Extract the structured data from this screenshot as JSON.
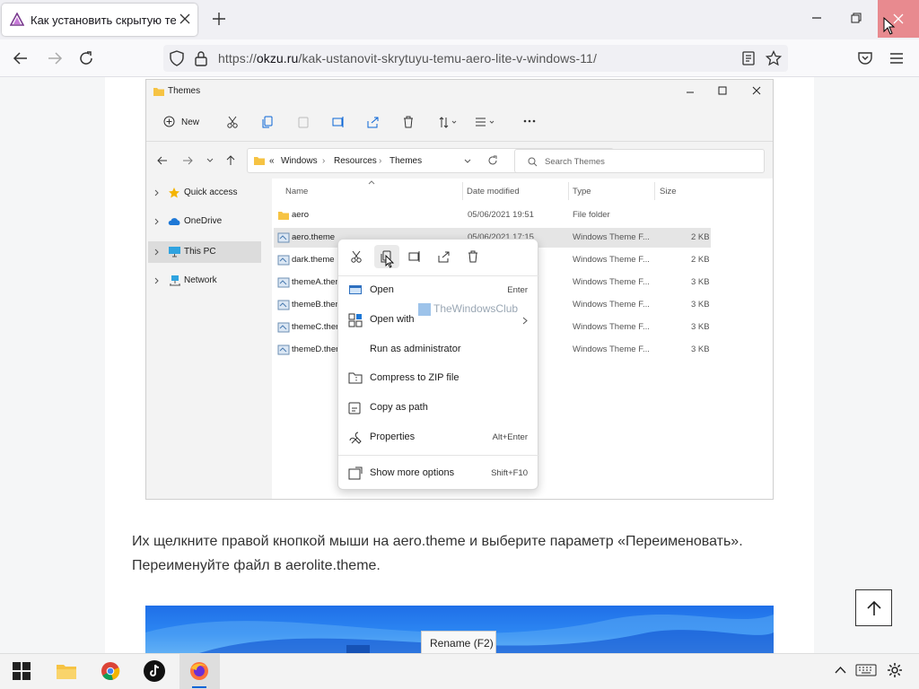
{
  "browser": {
    "tab_title": "Как установить скрытую тему",
    "url_domain": "okzu.ru",
    "url_path": "/kak-ustanovit-skrytuyu-temu-aero-lite-v-windows-11/"
  },
  "explorer": {
    "title": "Themes",
    "new_label": "New",
    "breadcrumb": [
      "Windows",
      "Resources",
      "Themes"
    ],
    "breadcrumb_prefix": "«",
    "search_placeholder": "Search Themes",
    "nav": [
      "Quick access",
      "OneDrive",
      "This PC",
      "Network"
    ],
    "columns": [
      "Name",
      "Date modified",
      "Type",
      "Size"
    ],
    "files": [
      {
        "name": "aero",
        "date": "05/06/2021 19:51",
        "type": "File folder",
        "size": ""
      },
      {
        "name": "aero.theme",
        "date": "05/06/2021 17:15",
        "type": "Windows Theme F...",
        "size": "2 KB"
      },
      {
        "name": "dark.theme",
        "date": "",
        "type": "Windows Theme F...",
        "size": "2 KB"
      },
      {
        "name": "themeA.ther",
        "date": "",
        "type": "Windows Theme F...",
        "size": "3 KB"
      },
      {
        "name": "themeB.ther",
        "date": "",
        "type": "Windows Theme F...",
        "size": "3 KB"
      },
      {
        "name": "themeC.ther",
        "date": "",
        "type": "Windows Theme F...",
        "size": "3 KB"
      },
      {
        "name": "themeD.ther",
        "date": "",
        "type": "Windows Theme F...",
        "size": "3 KB"
      }
    ]
  },
  "context_menu": {
    "open": "Open",
    "open_sc": "Enter",
    "open_with": "Open with",
    "run_admin": "Run as administrator",
    "compress": "Compress to ZIP file",
    "copy_path": "Copy as path",
    "properties": "Properties",
    "properties_sc": "Alt+Enter",
    "more": "Show more options",
    "more_sc": "Shift+F10"
  },
  "watermark": "TheWindowsClub",
  "article": {
    "paragraph": "Их щелкните правой кнопкой мыши на aero.theme и выберите параметр «Переименовать». Переименуйте файл в aerolite.theme."
  },
  "tooltip": "Rename (F2)",
  "colors": {
    "accent": "#0a64d6",
    "close_hover": "#e88a8f",
    "folder": "#f6c343"
  }
}
